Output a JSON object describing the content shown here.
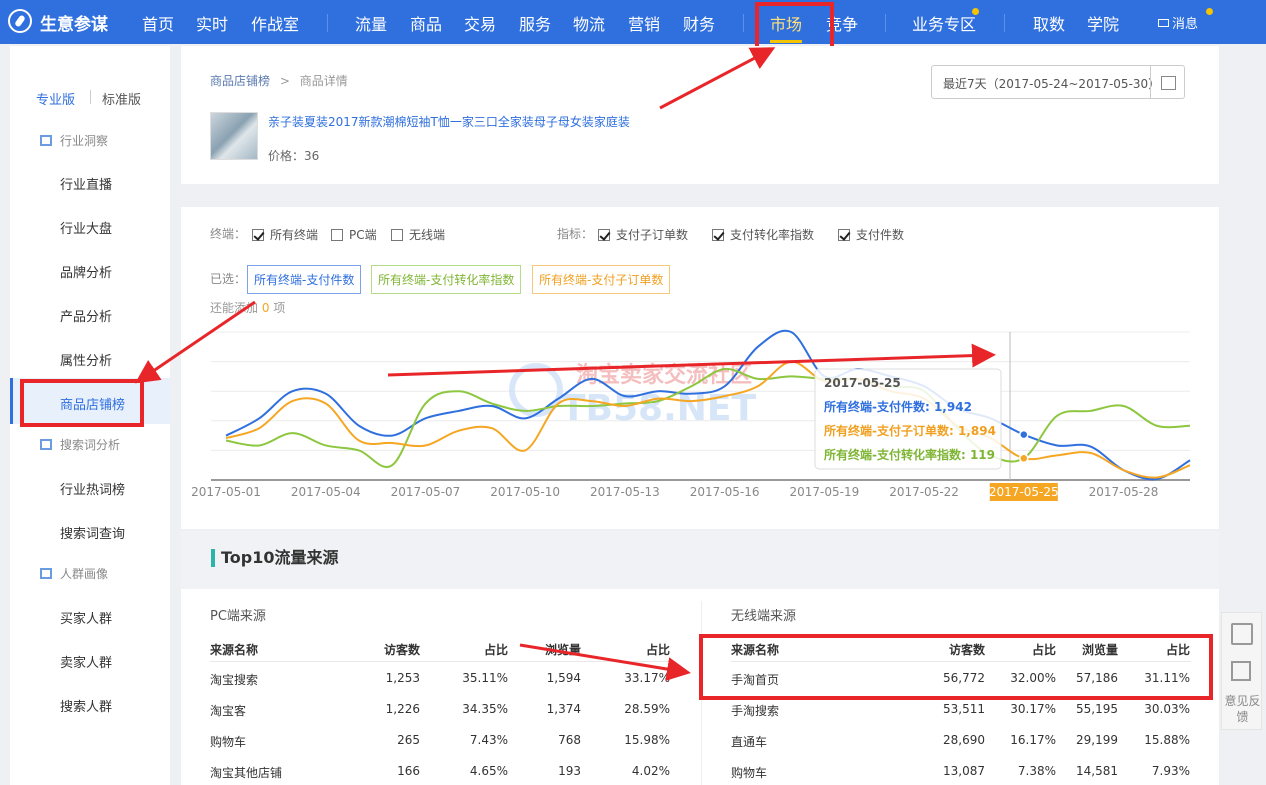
{
  "topnav": {
    "brand": "生意参谋",
    "items": [
      "首页",
      "实时",
      "作战室",
      "流量",
      "商品",
      "交易",
      "服务",
      "物流",
      "营销",
      "财务",
      "市场",
      "竞争",
      "业务专区",
      "取数",
      "学院"
    ],
    "message": "消息"
  },
  "sidebar": {
    "versions": [
      "专业版",
      "标准版"
    ],
    "sections": [
      {
        "title": "行业洞察",
        "items": [
          "行业直播",
          "行业大盘",
          "品牌分析",
          "产品分析",
          "属性分析",
          "商品店铺榜"
        ]
      },
      {
        "title": "搜索词分析",
        "items": [
          "行业热词榜",
          "搜索词查询"
        ]
      },
      {
        "title": "人群画像",
        "items": [
          "买家人群",
          "卖家人群",
          "搜索人群"
        ]
      }
    ]
  },
  "breadcrumb": {
    "root": "商品店铺榜",
    "sep": ">",
    "current": "商品详情"
  },
  "date_range": "最近7天（2017-05-24~2017-05-30）",
  "product": {
    "title": "亲子装夏装2017新款潮棉短袖T恤一家三口全家装母子母女装家庭装",
    "price": "价格：36"
  },
  "filters": {
    "terminal_label": "终端：",
    "terminals": [
      {
        "label": "所有终端",
        "checked": true
      },
      {
        "label": "PC端",
        "checked": false
      },
      {
        "label": "无线端",
        "checked": false
      }
    ],
    "metric_label": "指标：",
    "metrics": [
      {
        "label": "支付子订单数",
        "checked": true
      },
      {
        "label": "支付转化率指数",
        "checked": true
      },
      {
        "label": "支付件数",
        "checked": true
      }
    ],
    "selected_label": "已选：",
    "selected": [
      {
        "label": "所有终端-支付件数",
        "color": "#2f6fde"
      },
      {
        "label": "所有终端-支付转化率指数",
        "color": "#8dc63f"
      },
      {
        "label": "所有终端-支付子订单数",
        "color": "#f5a623"
      }
    ],
    "remain_prefix": "还能添加",
    "remain_count": "0",
    "remain_suffix": "项"
  },
  "chart_data": {
    "type": "line",
    "x": [
      "2017-05-01",
      "2017-05-02",
      "2017-05-03",
      "2017-05-04",
      "2017-05-05",
      "2017-05-06",
      "2017-05-07",
      "2017-05-08",
      "2017-05-09",
      "2017-05-10",
      "2017-05-11",
      "2017-05-12",
      "2017-05-13",
      "2017-05-14",
      "2017-05-15",
      "2017-05-16",
      "2017-05-17",
      "2017-05-18",
      "2017-05-19",
      "2017-05-20",
      "2017-05-21",
      "2017-05-22",
      "2017-05-23",
      "2017-05-24",
      "2017-05-25",
      "2017-05-26",
      "2017-05-27",
      "2017-05-28",
      "2017-05-29",
      "2017-05-30"
    ],
    "tick_labels": [
      "2017-05-01",
      "2017-05-04",
      "2017-05-07",
      "2017-05-10",
      "2017-05-13",
      "2017-05-16",
      "2017-05-19",
      "2017-05-22",
      "2017-05-25",
      "2017-05-28"
    ],
    "series": [
      {
        "name": "所有终端-支付件数",
        "color": "#2f6fde",
        "values": [
          1940,
          1975,
          2030,
          2025,
          1960,
          1940,
          1975,
          1990,
          2000,
          1975,
          2015,
          2055,
          2020,
          2030,
          2025,
          2040,
          2120,
          2150,
          2060,
          2075,
          2060,
          2040,
          1995,
          1975,
          1942,
          1920,
          1918,
          1870,
          1852,
          1890
        ]
      },
      {
        "name": "所有终端-支付转化率指数",
        "color": "#8dc63f",
        "values": [
          1930,
          1920,
          1945,
          1920,
          1910,
          1880,
          2005,
          2030,
          2005,
          1990,
          2000,
          2000,
          2005,
          2010,
          2040,
          2075,
          2055,
          2060,
          2055,
          2055,
          2040,
          2030,
          1955,
          1900,
          1894,
          1980,
          1990,
          2000,
          1960,
          1960
        ]
      },
      {
        "name": "所有终端-支付子订单数",
        "color": "#f5a623",
        "values": [
          1935,
          1955,
          2010,
          2005,
          1930,
          1925,
          1920,
          1950,
          1955,
          1910,
          2005,
          2010,
          2000,
          2015,
          2010,
          2020,
          2040,
          2090,
          2050,
          2055,
          2030,
          2015,
          1960,
          1935,
          1894,
          1900,
          1905,
          1870,
          1855,
          1880
        ]
      }
    ],
    "tooltip": {
      "date": "2017-05-25",
      "lines": [
        "所有终端-支付件数: 1,942",
        "所有终端-支付子订单数: 1,894",
        "所有终端-支付转化率指数: 119"
      ]
    },
    "highlight_tick": "2017-05-25",
    "grid": true
  },
  "watermark": {
    "line1": "淘宝卖家交流社区",
    "line2": "TB58.NET"
  },
  "top10": {
    "title": "Top10流量来源",
    "pc": {
      "caption": "PC端来源",
      "headers": [
        "来源名称",
        "访客数",
        "占比",
        "浏览量",
        "占比"
      ],
      "rows": [
        [
          "淘宝搜索",
          "1,253",
          "35.11%",
          "1,594",
          "33.17%"
        ],
        [
          "淘宝客",
          "1,226",
          "34.35%",
          "1,374",
          "28.59%"
        ],
        [
          "购物车",
          "265",
          "7.43%",
          "768",
          "15.98%"
        ],
        [
          "淘宝其他店铺",
          "166",
          "4.65%",
          "193",
          "4.02%"
        ]
      ]
    },
    "mobile": {
      "caption": "无线端来源",
      "headers": [
        "来源名称",
        "访客数",
        "占比",
        "浏览量",
        "占比"
      ],
      "rows": [
        [
          "手淘首页",
          "56,772",
          "32.00%",
          "57,186",
          "31.11%"
        ],
        [
          "手淘搜索",
          "53,511",
          "30.17%",
          "55,195",
          "30.03%"
        ],
        [
          "直通车",
          "28,690",
          "16.17%",
          "29,199",
          "15.88%"
        ],
        [
          "购物车",
          "13,087",
          "7.38%",
          "14,581",
          "7.93%"
        ]
      ]
    }
  },
  "tools": {
    "feedback": "意见反馈"
  }
}
